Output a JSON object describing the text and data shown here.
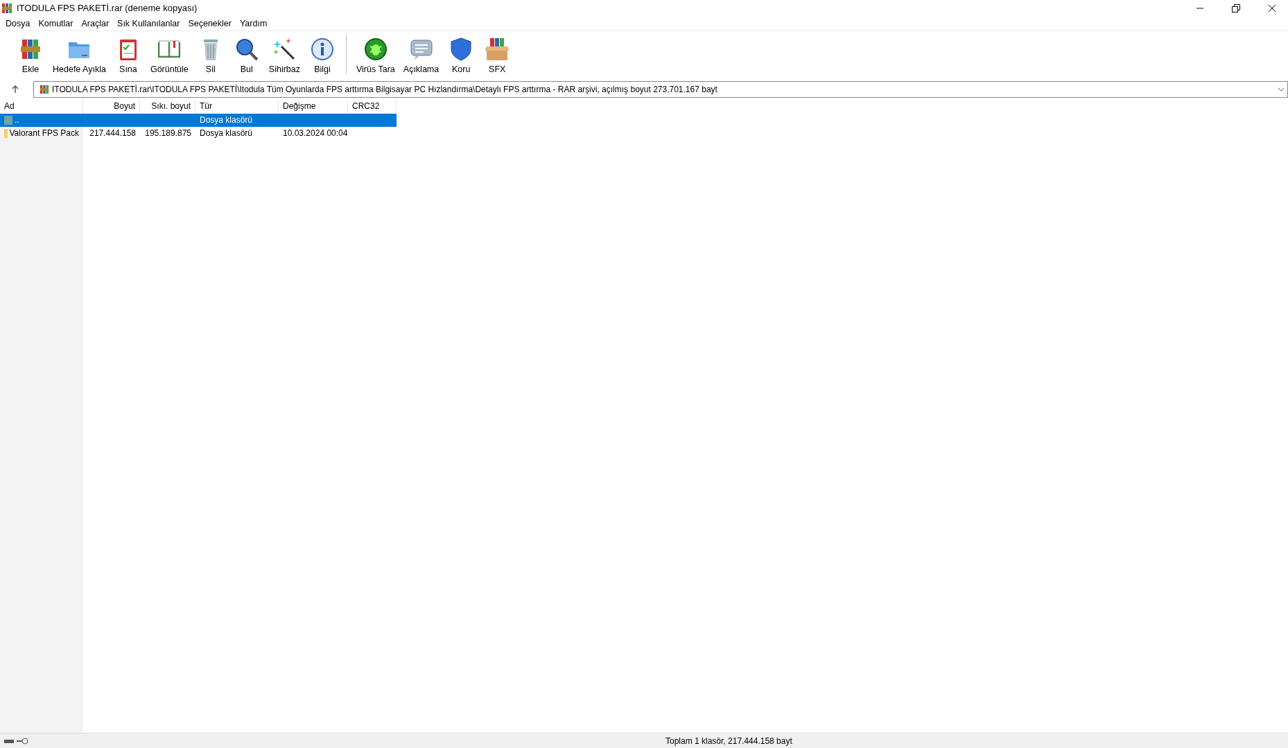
{
  "window": {
    "title": "ITODULA FPS PAKETİ.rar (deneme kopyası)"
  },
  "menu": [
    "Dosya",
    "Komutlar",
    "Araçlar",
    "Sık Kullanılanlar",
    "Seçenekler",
    "Yardım"
  ],
  "toolbar": [
    {
      "label": "Ekle",
      "kind": "archive"
    },
    {
      "label": "Hedefe Ayıkla",
      "kind": "folder"
    },
    {
      "label": "Sına",
      "kind": "clipboard"
    },
    {
      "label": "Görüntüle",
      "kind": "book"
    },
    {
      "label": "Sil",
      "kind": "trash"
    },
    {
      "label": "Bul",
      "kind": "magnifier"
    },
    {
      "label": "Sihirbaz",
      "kind": "wand"
    },
    {
      "label": "Bilgi",
      "kind": "info"
    },
    {
      "label": "Virüs Tara",
      "kind": "bug",
      "separator_before": true
    },
    {
      "label": "Açıklama",
      "kind": "comment"
    },
    {
      "label": "Koru",
      "kind": "shield"
    },
    {
      "label": "SFX",
      "kind": "box"
    }
  ],
  "address": {
    "path": "ITODULA FPS PAKETİ.rar\\ITODULA FPS PAKETİ\\Itodula Tüm Oyunlarda FPS arttırma Bilgisayar PC Hızlandırma\\Detaylı FPS arttırma - RAR arşivi, açılmış boyut 273.701.167 bayt"
  },
  "table": {
    "columns": [
      "Ad",
      "Boyut",
      "Sıkı. boyut",
      "Tür",
      "Değişme",
      "CRC32"
    ],
    "rows": [
      {
        "kind": "parent",
        "selected": true,
        "cells": [
          "..",
          "",
          "",
          "Dosya klasörü",
          "",
          ""
        ]
      },
      {
        "kind": "folder",
        "selected": false,
        "cells": [
          "Valorant FPS Pack",
          "217.444.158",
          "195.189.875",
          "Dosya klasörü",
          "10.03.2024 00:04",
          ""
        ]
      }
    ]
  },
  "status_bar": {
    "text": "Toplam 1 klasör, 217.444.158 bayt"
  }
}
